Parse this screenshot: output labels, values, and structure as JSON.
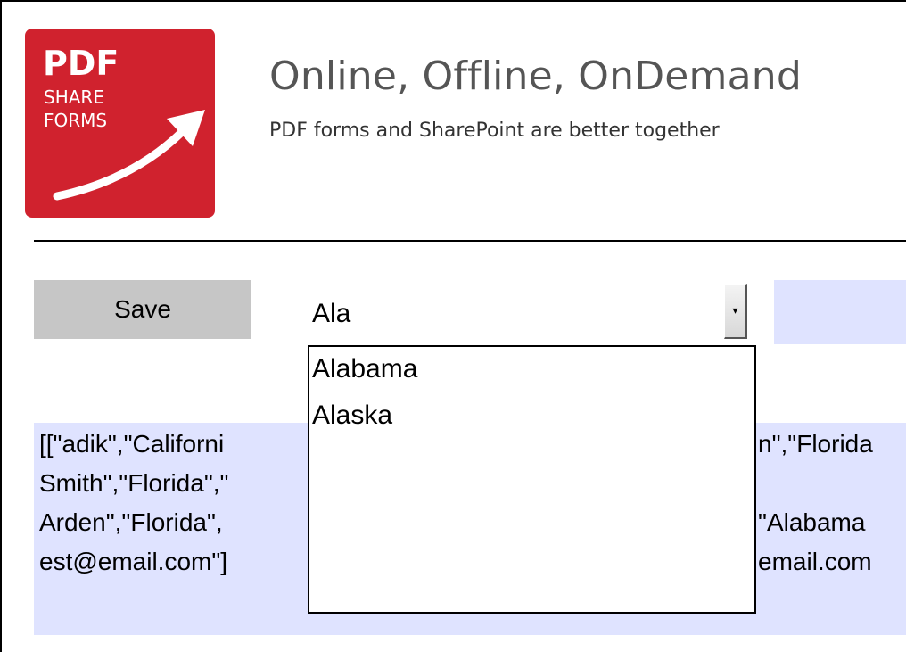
{
  "logo": {
    "line1": "PDF",
    "line2": "SHARE",
    "line3": "FORMS",
    "brand_color": "#d0222e",
    "icon": "arrow-up-right-icon"
  },
  "header": {
    "title": "Online, Offline, OnDemand",
    "subtitle": "PDF forms and SharePoint are better together"
  },
  "toolbar": {
    "save_label": "Save"
  },
  "combo": {
    "value": "Ala",
    "arrow_glyph": "▾",
    "options": [
      "Alabama",
      "Alaska"
    ]
  },
  "output": {
    "lines": [
      "[[\"adik\",\"Californi",
      "Smith\",\"Florida\",\"",
      "Arden\",\"Florida\",",
      "est@email.com\"]"
    ],
    "right_fragments": [
      "n\",\"Florida",
      "",
      "\"Alabama",
      "email.com"
    ],
    "background_color": "#dfe3ff"
  }
}
